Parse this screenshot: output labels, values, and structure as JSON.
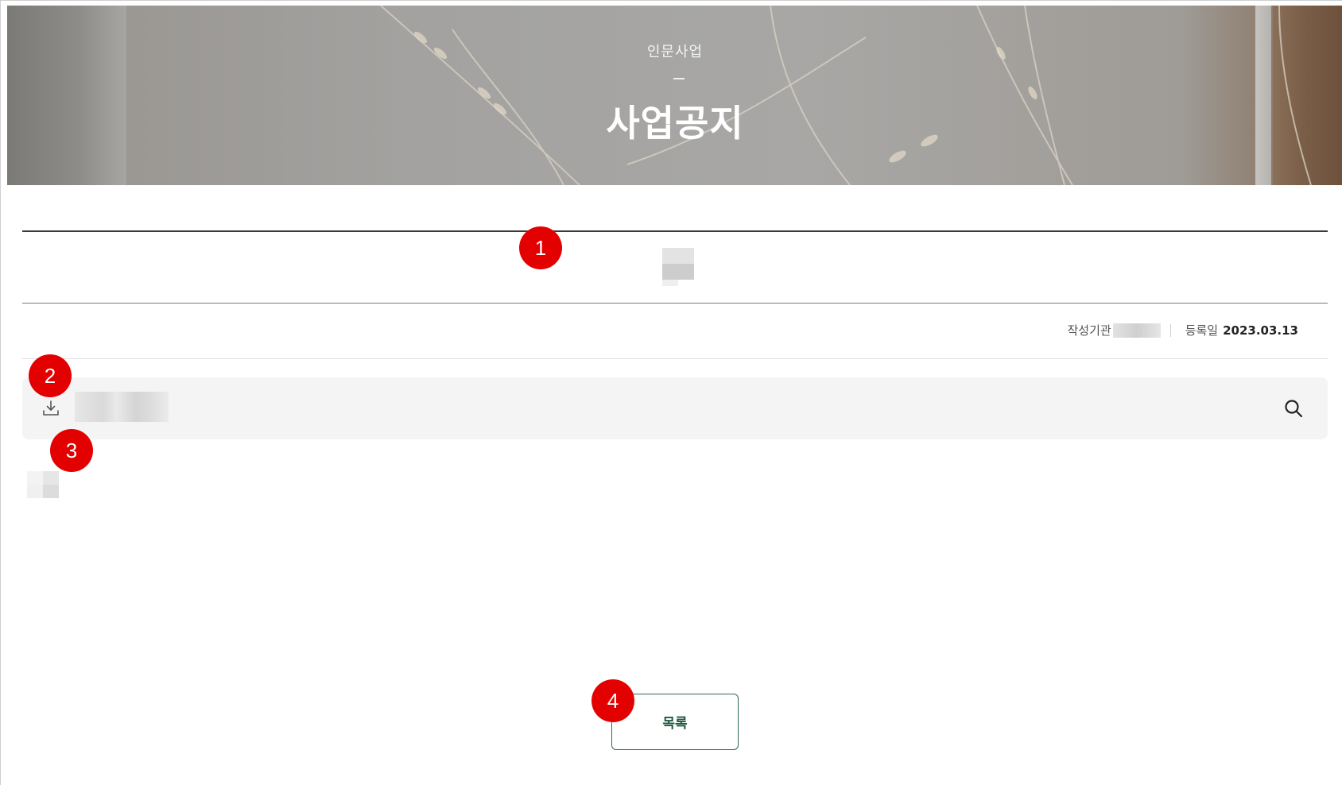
{
  "hero": {
    "subtitle": "인문사업",
    "title": "사업공지"
  },
  "meta": {
    "author_label": "작성기관",
    "date_label": "등록일",
    "date_value": "2023.03.13"
  },
  "attachment": {
    "download_icon": "download-icon",
    "search_icon": "search-icon"
  },
  "list_button": {
    "label": "목록"
  },
  "markers": [
    "1",
    "2",
    "3",
    "4"
  ],
  "colors": {
    "marker": "#e30000",
    "accent": "#2f6b4f",
    "attach_bg": "#f4f4f4"
  }
}
